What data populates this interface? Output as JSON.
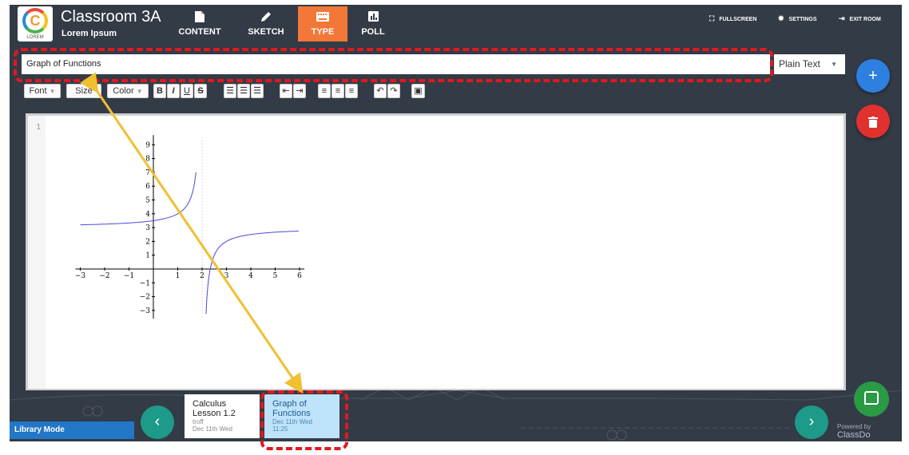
{
  "header": {
    "logo_text": "LOREM",
    "room_title": "Classroom 3A",
    "room_subtitle": "Lorem Ipsum",
    "tabs": [
      {
        "label": "CONTENT",
        "icon": "file-icon"
      },
      {
        "label": "SKETCH",
        "icon": "pencil-icon"
      },
      {
        "label": "TYPE",
        "icon": "keyboard-icon"
      },
      {
        "label": "POLL",
        "icon": "bar-chart-icon"
      }
    ],
    "active_tab": "TYPE",
    "links": {
      "fullscreen": "FULLSCREEN",
      "settings": "SETTINGS",
      "exit": "EXIT ROOM"
    }
  },
  "editor": {
    "title_value": "Graph of Functions",
    "format_value": "Plain Text",
    "line_number": "1",
    "toolbar": {
      "font": "Font",
      "size": "Size",
      "color": "Color"
    }
  },
  "graph": {
    "x_ticks": [
      "−3",
      "−2",
      "−1",
      "1",
      "2",
      "3",
      "4",
      "5",
      "6"
    ],
    "y_ticks": [
      "9",
      "8",
      "7",
      "6",
      "5",
      "4",
      "3",
      "2",
      "1",
      "−1",
      "−2",
      "−3"
    ]
  },
  "footer": {
    "mode_label": "Library Mode",
    "cards": [
      {
        "title": "Calculus Lesson 1.2",
        "author": "troff",
        "date": "Dec 11th Wed"
      },
      {
        "title": "Graph of Functions",
        "date": "Dec 11th Wed",
        "time": "11:25"
      }
    ],
    "powered_by": "Powered by",
    "brand": "ClassDo"
  },
  "colors": {
    "background": "#333b47",
    "accent": "#f37736",
    "add_button": "#2d7fe0",
    "delete_button": "#e0312e",
    "highlight": "#e0191f",
    "arrow": "#f0c030",
    "selected_card": "#bfe3fb",
    "nav_button": "#1d9a8a"
  }
}
